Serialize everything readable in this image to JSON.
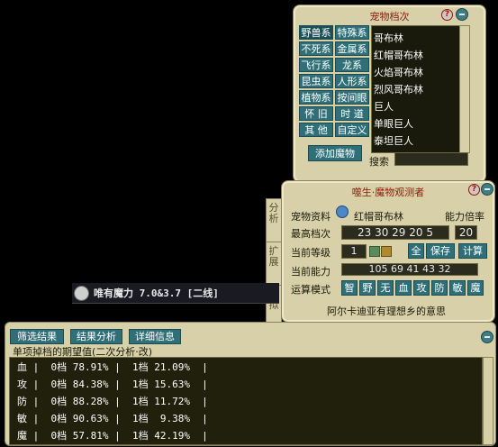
{
  "pet_panel": {
    "title": "宠物档次",
    "categories": [
      "野兽系",
      "特殊系",
      "不死系",
      "金属系",
      "飞行系",
      "龙系",
      "昆虫系",
      "人形系",
      "植物系",
      "按间眼",
      "怀 旧",
      "时 道",
      "其 他",
      "自定义"
    ],
    "pets": [
      "哥布林",
      "红帽哥布林",
      "火焰哥布林",
      "烈风哥布林",
      "巨人",
      "单眼巨人",
      "泰坦巨人"
    ],
    "add_button": "添加魔物",
    "search_label": "搜索",
    "search_value": ""
  },
  "observer_panel": {
    "title": "噬生·魔物观测者",
    "side_tabs": [
      "分析",
      "扩展",
      "模拟"
    ],
    "pet_info_label": "宠物资料",
    "pet_info_value": "红帽哥布林",
    "multiplier_label": "能力倍率",
    "top_grade_label": "最高档次",
    "top_grade_value": "23 30 29 20 5",
    "multiplier_value": "20",
    "level_label": "当前等级",
    "level_value": "1",
    "all_button": "全",
    "save_button": "保存",
    "calc_button": "计算",
    "ability_label": "当前能力",
    "ability_value": "105 69 41 43 32",
    "mode_label": "运算模式",
    "modes": [
      "智",
      "野",
      "无",
      "血",
      "攻",
      "防",
      "敏",
      "魔"
    ],
    "footer_text": "阿尔卡迪亚有理想乡的意思"
  },
  "game_label": "唯有魔力 7.0&3.7 [二线]",
  "result_panel": {
    "buttons": [
      "筛选结果",
      "结果分析",
      "详细信息"
    ],
    "header": "单项掉档的期望值(二次分析·改)",
    "rows": [
      "血 |  0档 78.91% |  1档 21.09%  |",
      "攻 |  0档 84.38% |  1档 15.63%  |",
      "防 |  0档 88.28% |  1档 11.72%  |",
      "敏 |  0档 90.63% |  1档  9.38%  |",
      "魔 |  0档 57.81% |  1档 42.19%  |"
    ]
  }
}
